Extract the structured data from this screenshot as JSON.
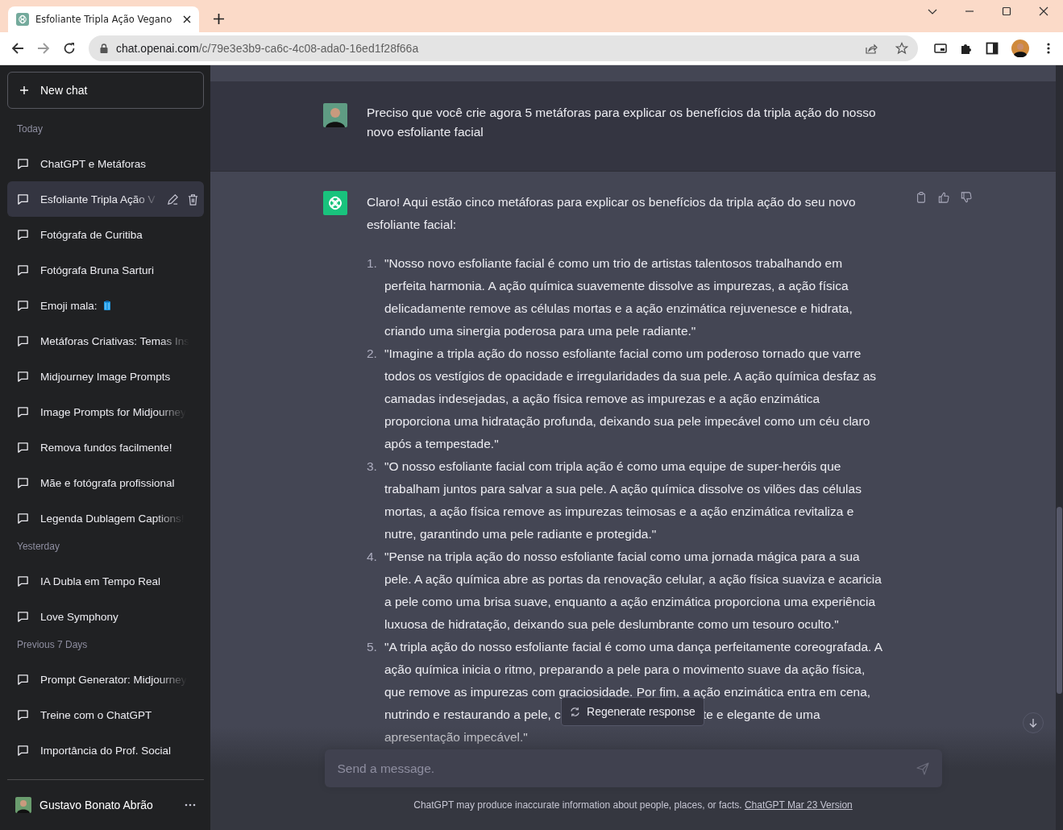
{
  "browser": {
    "tab": {
      "title": "Esfoliante Tripla Ação Vegano"
    },
    "forward_disabled": true,
    "address": {
      "host": "chat.openai.com",
      "path": "/c/79e3e3b9-ca6c-4c08-ada0-16ed1f28f66a"
    }
  },
  "sidebar": {
    "new_chat": "New chat",
    "groups": [
      {
        "label": "Today",
        "items": [
          {
            "title": "ChatGPT e Metáforas",
            "selected": false,
            "truncated": false
          },
          {
            "title": "Esfoliante Tripla Ação V",
            "selected": true,
            "truncated": true
          },
          {
            "title": "Fotógrafa de Curitiba",
            "selected": false,
            "truncated": false
          },
          {
            "title": "Fotógrafa Bruna Sarturi",
            "selected": false,
            "truncated": false
          },
          {
            "title": "Emoji mala:",
            "selected": false,
            "truncated": false,
            "kind": "with_suitcase"
          },
          {
            "title": "Metáforas Criativas: Temas Ins",
            "selected": false,
            "truncated": true
          },
          {
            "title": "Midjourney Image Prompts",
            "selected": false,
            "truncated": false
          },
          {
            "title": "Image Prompts for Midjourney",
            "selected": false,
            "truncated": true
          },
          {
            "title": "Remova fundos facilmente!",
            "selected": false,
            "truncated": false
          },
          {
            "title": "Mãe e fotógrafa profissional",
            "selected": false,
            "truncated": false
          },
          {
            "title": "Legenda Dublagem Captions!",
            "selected": false,
            "truncated": true
          }
        ]
      },
      {
        "label": "Yesterday",
        "items": [
          {
            "title": "IA Dubla em Tempo Real",
            "selected": false,
            "truncated": false
          },
          {
            "title": "Love Symphony",
            "selected": false,
            "truncated": false
          }
        ]
      },
      {
        "label": "Previous 7 Days",
        "items": [
          {
            "title": "Prompt Generator: Midjourney",
            "selected": false,
            "truncated": true
          },
          {
            "title": "Treine com o ChatGPT",
            "selected": false,
            "truncated": false
          },
          {
            "title": "Importância do Prof. Social",
            "selected": false,
            "truncated": false
          }
        ]
      }
    ],
    "user": {
      "name": "Gustavo Bonato Abrão"
    }
  },
  "chat": {
    "user_message": "Preciso que você crie agora 5 metáforas para explicar os benefícios da tripla ação do nosso novo esfoliante facial",
    "assistant": {
      "intro": "Claro! Aqui estão cinco metáforas para explicar os benefícios da tripla ação do seu novo esfoliante facial:",
      "items": [
        {
          "number": "1.",
          "text": "\"Nosso novo esfoliante facial é como um trio de artistas talentosos trabalhando em perfeita harmonia. A ação química suavemente dissolve as impurezas, a ação física delicadamente remove as células mortas e a ação enzimática rejuvenesce e hidrata, criando uma sinergia poderosa para uma pele radiante.\""
        },
        {
          "number": "2.",
          "text": "\"Imagine a tripla ação do nosso esfoliante facial como um poderoso tornado que varre todos os vestígios de opacidade e irregularidades da sua pele. A ação química desfaz as camadas indesejadas, a ação física remove as impurezas e a ação enzimática proporciona uma hidratação profunda, deixando sua pele impecável como um céu claro após a tempestade.\""
        },
        {
          "number": "3.",
          "text": "\"O nosso esfoliante facial com tripla ação é como uma equipe de super-heróis que trabalham juntos para salvar a sua pele. A ação química dissolve os vilões das células mortas, a ação física remove as impurezas teimosas e a ação enzimática revitaliza e nutre, garantindo uma pele radiante e protegida.\""
        },
        {
          "number": "4.",
          "text": "\"Pense na tripla ação do nosso esfoliante facial como uma jornada mágica para a sua pele. A ação química abre as portas da renovação celular, a ação física suaviza e acaricia a pele como uma brisa suave, enquanto a ação enzimática proporciona uma experiência luxuosa de hidratação, deixando sua pele deslumbrante como um tesouro oculto.\""
        },
        {
          "number": "5.",
          "text": "\"A tripla ação do nosso esfoliante facial é como uma dança perfeitamente coreografada. A ação química inicia o ritmo, preparando a pele para o movimento suave da ação física, que remove as impurezas com graciosidade. Por fim, a ação enzimática entra em cena, nutrindo e restaurando a pele, c",
          "text_after": "te e elegante de uma apresentação impecável.\""
        }
      ]
    }
  },
  "regenerate": "Regenerate response",
  "composer": {
    "placeholder": "Send a message."
  },
  "footer": {
    "text": "ChatGPT may produce inaccurate information about people, places, or facts.",
    "link": "ChatGPT Mar 23 Version"
  }
}
